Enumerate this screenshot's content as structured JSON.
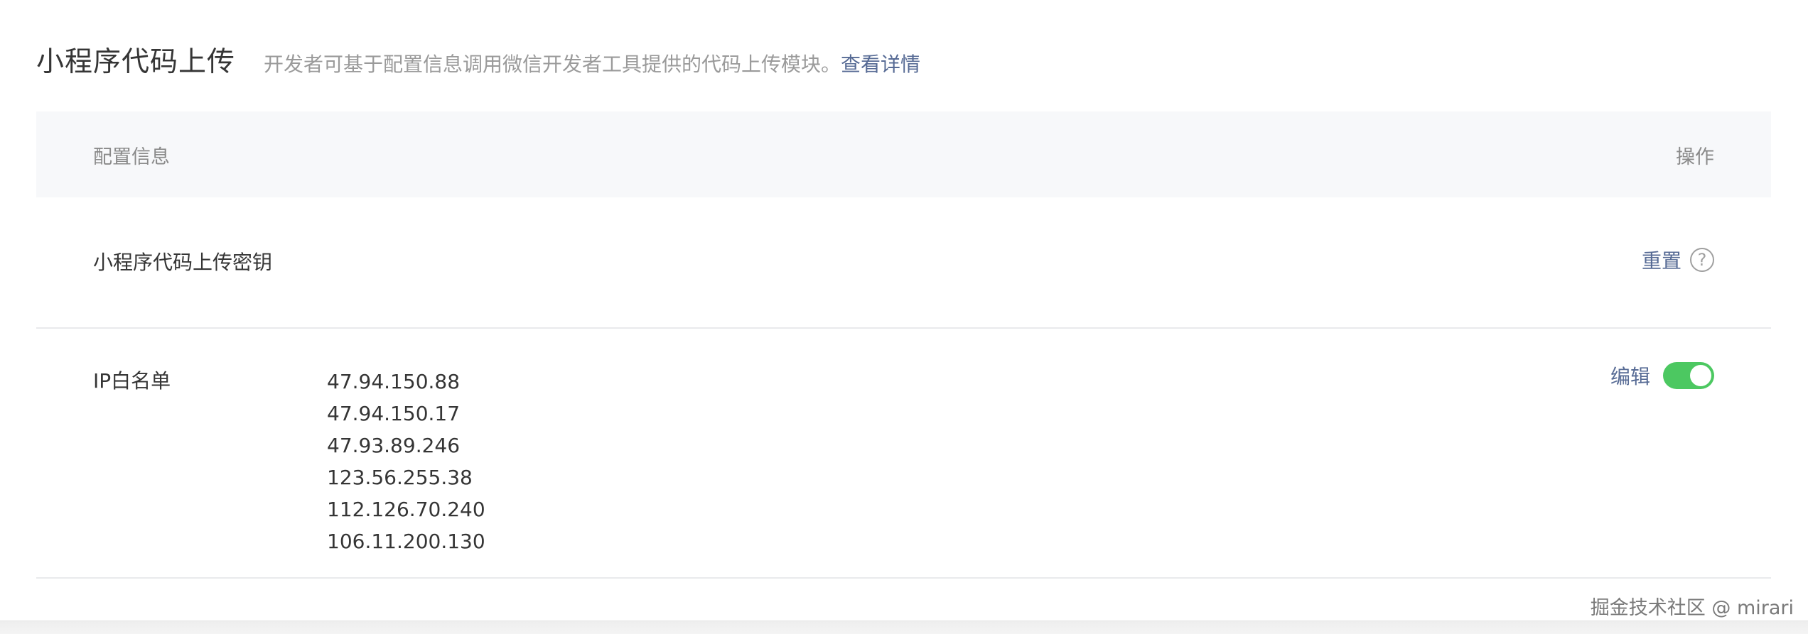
{
  "header": {
    "title": "小程序代码上传",
    "description": "开发者可基于配置信息调用微信开发者工具提供的代码上传模块。",
    "link_label": "查看详情"
  },
  "table": {
    "columns": [
      "配置信息",
      "操作"
    ],
    "key_row": {
      "label": "小程序代码上传密钥",
      "action_label": "重置",
      "help_icon": "question-circle-icon"
    },
    "ip_row": {
      "label": "IP白名单",
      "ips": [
        "47.94.150.88",
        "47.94.150.17",
        "47.93.89.246",
        "123.56.255.38",
        "112.126.70.240",
        "106.11.200.130"
      ],
      "action_label": "编辑",
      "toggle_on": true
    }
  },
  "watermark": "掘金技术社区 @ mirari",
  "colors": {
    "link": "#576b95",
    "toggle_on": "#4cc861",
    "header_bg": "#f7f8fa"
  }
}
